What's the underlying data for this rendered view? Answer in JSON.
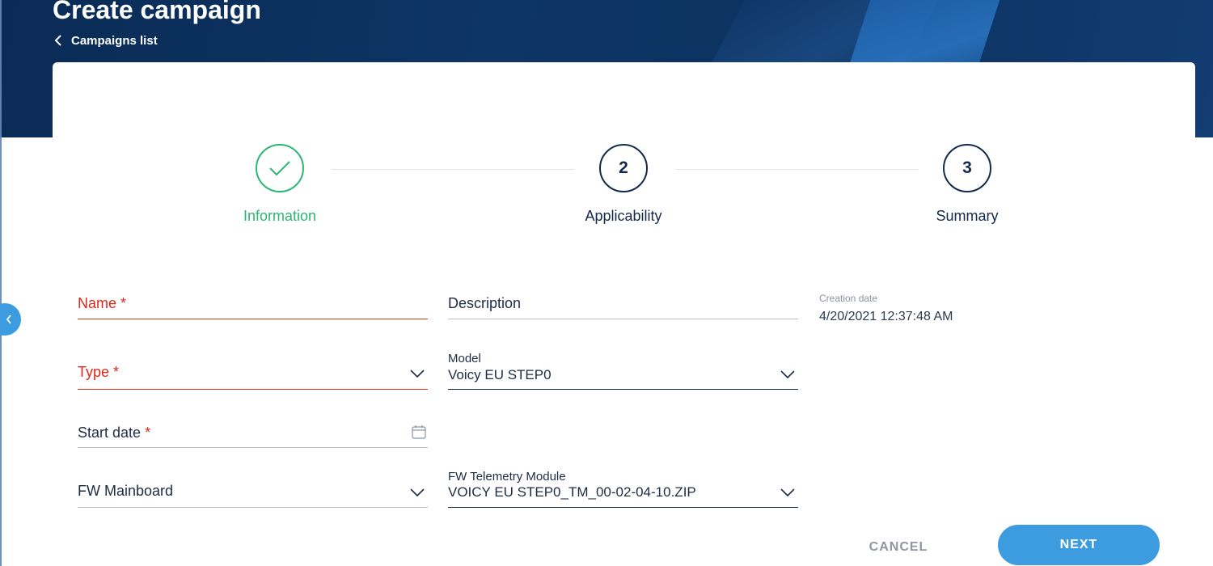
{
  "header": {
    "title": "Create campaign",
    "back_label": "Campaigns list"
  },
  "stepper": {
    "steps": [
      {
        "label": "Information",
        "number": "1",
        "state": "done"
      },
      {
        "label": "Applicability",
        "number": "2",
        "state": "pending"
      },
      {
        "label": "Summary",
        "number": "3",
        "state": "pending"
      }
    ]
  },
  "form": {
    "name": {
      "label": "Name",
      "required_mark": "*",
      "value": ""
    },
    "description": {
      "label": "Description",
      "value": ""
    },
    "creation_date": {
      "label": "Creation date",
      "value": "4/20/2021 12:37:48 AM"
    },
    "type": {
      "label": "Type",
      "required_mark": "*",
      "value": ""
    },
    "model": {
      "label": "Model",
      "value": "Voicy EU STEP0"
    },
    "start_date": {
      "label": "Start date",
      "required_mark": "*",
      "value": ""
    },
    "fw_mainboard": {
      "label": "FW Mainboard",
      "value": ""
    },
    "fw_telemetry": {
      "label": "FW Telemetry Module",
      "value": "VOICY EU STEP0_TM_00-02-04-10.ZIP"
    }
  },
  "actions": {
    "cancel_label": "CANCEL",
    "next_label": "NEXT"
  },
  "colors": {
    "header_bg": "#0c3260",
    "accent": "#3d9be0",
    "success": "#2bb673",
    "error": "#e0261a"
  },
  "icons": {
    "back": "chevron-left-icon",
    "done_step": "check-icon",
    "dropdown": "chevron-down-icon",
    "date": "calendar-icon",
    "sidebar_toggle": "chevron-left-icon"
  }
}
